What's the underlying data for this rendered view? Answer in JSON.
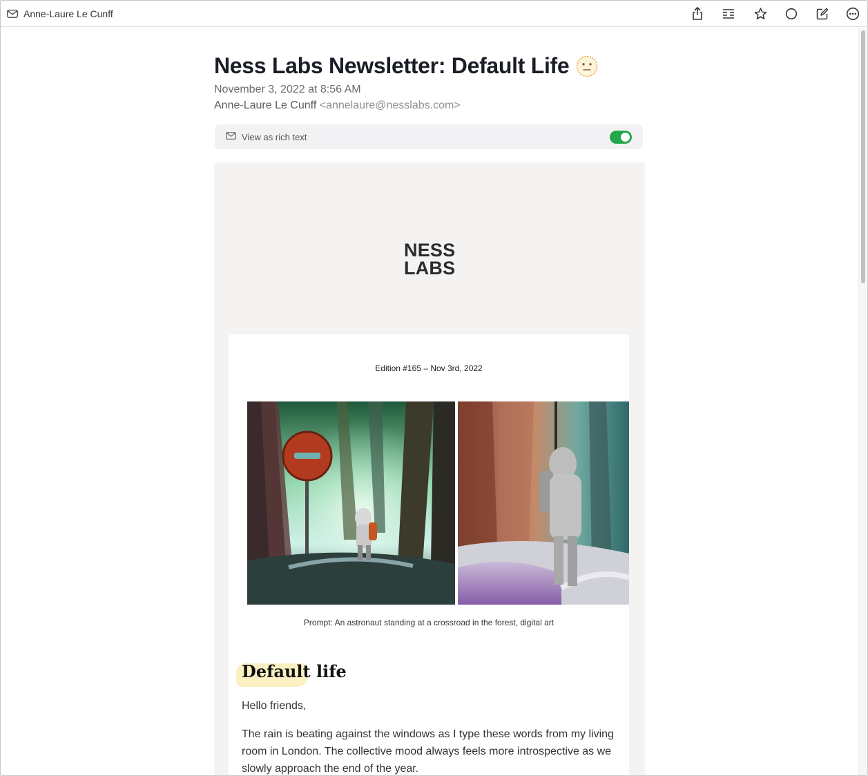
{
  "window": {
    "title": "Anne-Laure Le Cunff"
  },
  "toolbar": {
    "icons": [
      "share-icon",
      "reader-icon",
      "star-icon",
      "circle-icon",
      "compose-icon",
      "more-icon"
    ]
  },
  "email": {
    "subject": "Ness Labs Newsletter: Default Life",
    "subject_emoji": "neutral-face-emoji",
    "date": "November 3, 2022 at 8:56 AM",
    "sender_name": "Anne-Laure Le Cunff",
    "sender_address": "<annelaure@nesslabs.com>",
    "rich_text_label": "View as rich text",
    "rich_text_enabled": true
  },
  "newsletter": {
    "logo_line1": "NESS",
    "logo_line2": "LABS",
    "edition": "Edition #165 – Nov 3rd, 2022",
    "caption": "Prompt: An astronaut standing at a crossroad in the forest, digital art",
    "heading_highlighted": "Default",
    "heading_rest": " life",
    "greeting": "Hello friends,",
    "paragraph1": "The rain is beating against the windows as I type these words from my living room in London. The collective mood always feels more introspective as we slowly approach the end of the year."
  },
  "colors": {
    "toggle_on": "#22a84a",
    "highlight": "#fbf0c2",
    "canvas": "#f4f3f2"
  }
}
